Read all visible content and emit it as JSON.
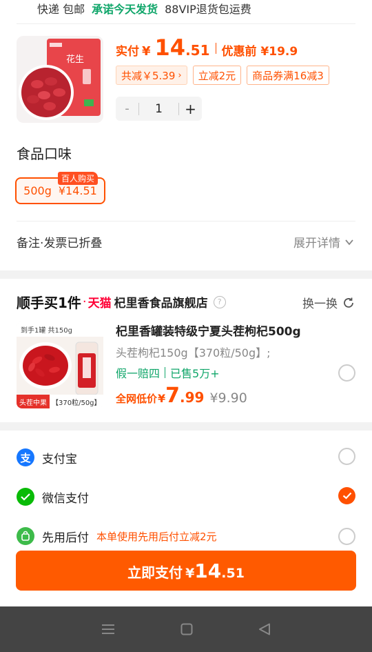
{
  "shipping": {
    "express": "快递 包邮",
    "promise": "承诺今天发货",
    "vip": "88VIP退货包运费"
  },
  "product": {
    "thumb_alt": "花生",
    "pay_label": "实付",
    "currency": "¥",
    "price_int": "14",
    "price_dec": ".51",
    "original_price": "优惠前 ¥19.9",
    "discount_total": "共减￥5.39",
    "coupon_1": "立减2元",
    "coupon_2": "商品券满16减3",
    "quantity": "1",
    "minus": "-",
    "plus": "+"
  },
  "flavor": {
    "title": "食品口味",
    "variant_weight": "500g",
    "variant_price": "¥14.51",
    "badge": "百人购买"
  },
  "remark": {
    "label": "备注·发票已折叠",
    "expand": "展开详情"
  },
  "recommend": {
    "title": "顺手买1件",
    "dot": "·",
    "tmall": "天猫",
    "store": "杞里香食品旗舰店",
    "swap": "换一换",
    "thumb_cap_top": "到手1罐 共150g",
    "thumb_cap_left": "头茬中果",
    "thumb_cap_right": "【370粒/50g】",
    "name": "杞里香罐装特级宁夏头茬枸杞500g",
    "spec": "头茬枸杞150g【370粒/50g】;",
    "guarantee": "假一赔四",
    "sold": "已售5万+",
    "price_label": "全网低价",
    "price_yen": "¥",
    "price_int": "7",
    "price_dec": ".99",
    "price_orig": "¥9.90"
  },
  "payment": {
    "alipay": "支付宝",
    "wechat": "微信支付",
    "later": "先用后付",
    "later_promo": "本单使用先用后付立减2元",
    "alipay_icon": "支",
    "selected": "wechat"
  },
  "pay_button": {
    "label": "立即支付",
    "yen": "¥",
    "int": "14",
    "dec": ".51"
  },
  "colors": {
    "accent": "#ff5000",
    "green": "#10a66a",
    "alipay": "#1677ff",
    "wechat": "#09bb07"
  }
}
